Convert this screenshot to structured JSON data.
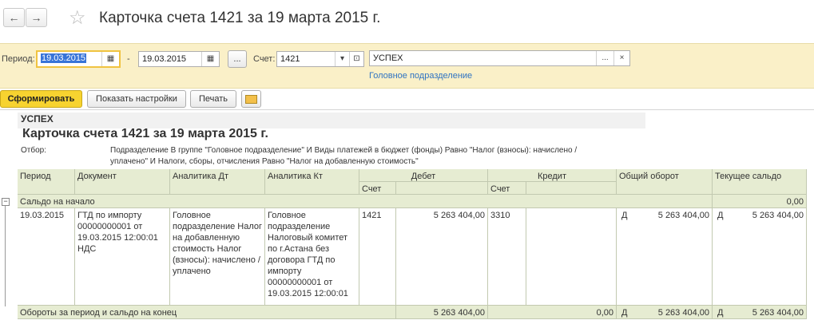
{
  "window": {
    "title": "Карточка счета 1421  за 19 марта 2015 г.",
    "back_icon": "←",
    "forward_icon": "→",
    "star_icon": "☆"
  },
  "filters": {
    "period_label": "Период:",
    "date_from": "19.03.2015",
    "dash": "-",
    "date_to": "19.03.2015",
    "period_btn": "...",
    "account_label": "Счет:",
    "account": "1421",
    "org": "УСПЕХ",
    "org_btn": "...",
    "org_clear": "×",
    "subdivision_link": "Головное подразделение"
  },
  "toolbar": {
    "generate": "Сформировать",
    "show_settings": "Показать настройки",
    "print": "Печать"
  },
  "report": {
    "org": "УСПЕХ",
    "heading": "Карточка счета 1421  за 19 марта 2015 г.",
    "filter_label": "Отбор:",
    "filter_line1": "Подразделение В группе \"Головное подразделение\" И Виды платежей в бюджет (фонды) Равно \"Налог (взносы): начислено /",
    "filter_line2": "уплачено\" И Налоги, сборы, отчисления Равно \"Налог на добавленную стоимость\"",
    "columns": {
      "period": "Период",
      "document": "Документ",
      "analytic_dt": "Аналитика Дт",
      "analytic_kt": "Аналитика Кт",
      "debit": "Дебет",
      "credit": "Кредит",
      "turnover": "Общий оборот",
      "balance": "Текущее сальдо",
      "account": "Счет"
    },
    "opening": {
      "label": "Сальдо на начало",
      "value": "0,00"
    },
    "row": {
      "period": "19.03.2015",
      "document": "ГТД по импорту 00000000001 от 19.03.2015 12:00:01 НДС",
      "analytic_dt": "Головное подразделение Налог на добавленную стоимость Налог (взносы): начислено / уплачено",
      "analytic_kt": "Головное подразделение Налоговый комитет по г.Астана без договора ГТД по импорту 00000000001 от 19.03.2015 12:00:01",
      "debit_account": "1421",
      "debit_sum": "5 263 404,00",
      "credit_account": "3310",
      "turnover_side": "Д",
      "turnover_sum": "5 263 404,00",
      "balance_side": "Д",
      "balance_sum": "5 263 404,00"
    },
    "totals": {
      "label": "Обороты за период и сальдо на конец",
      "debit": "5 263 404,00",
      "credit": "0,00",
      "turnover_side": "Д",
      "turnover_sum": "5 263 404,00",
      "balance_side": "Д",
      "balance_sum": "5 263 404,00"
    },
    "collapse_icon": "−"
  }
}
